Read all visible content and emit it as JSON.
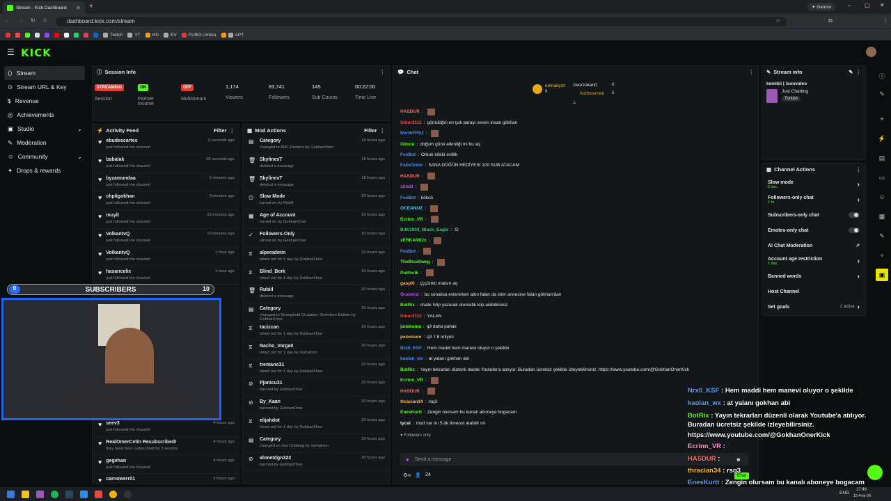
{
  "browser": {
    "tab_title": "Stream - Kick Dashboard",
    "url": "dashboard.kick.com/stream",
    "gemini": "Gemini",
    "bookmarks": [
      "Twitch",
      "YT",
      "HD",
      "EV",
      "PUBG Umbra",
      "APT"
    ]
  },
  "header": {
    "logo": "KICK"
  },
  "sidebar": {
    "items": [
      {
        "label": "Stream"
      },
      {
        "label": "Stream URL & Key"
      },
      {
        "label": "Revenue"
      },
      {
        "label": "Achievements"
      },
      {
        "label": "Studio"
      },
      {
        "label": "Moderation"
      },
      {
        "label": "Community"
      },
      {
        "label": "Drops & rewards"
      }
    ]
  },
  "session": {
    "title": "Session Info",
    "stats": [
      {
        "badge": "STREAMING",
        "label": "Session"
      },
      {
        "badge": "ON",
        "label": "Partner Income"
      },
      {
        "badge": "OFF",
        "label": "Multistream"
      },
      {
        "value": "1,174",
        "label": "Viewers"
      },
      {
        "value": "83,741",
        "label": "Followers"
      },
      {
        "value": "145",
        "label": "Sub Counts"
      },
      {
        "value": "00:22:00",
        "label": "Time Live"
      }
    ]
  },
  "activity": {
    "title": "Activity Feed",
    "filter": "Filter",
    "rows": [
      {
        "name": "ebudescartes",
        "sub": "just followed the channel",
        "time": "0 seconds ago"
      },
      {
        "name": "babalak",
        "sub": "just followed the channel",
        "time": "28 seconds ago"
      },
      {
        "name": "byzamundaa",
        "sub": "just followed the channel",
        "time": "2 minutes ago"
      },
      {
        "name": "chpligokhan",
        "sub": "just followed the channel",
        "time": "3 minutes ago"
      },
      {
        "name": "muyit",
        "sub": "just followed the channel",
        "time": "13 minutes ago"
      },
      {
        "name": "VolkantvQ",
        "sub": "just followed the channel",
        "time": "19 minutes ago"
      },
      {
        "name": "VolkantvQ",
        "sub": "just followed the channel",
        "time": "1 hour ago"
      },
      {
        "name": "hasancelix",
        "sub": "just followed the channel",
        "time": "1 hour ago"
      }
    ],
    "rows_bottom": [
      {
        "name": "seev3",
        "sub": "just followed the channel",
        "time": "4 hours ago"
      },
      {
        "name": "RealOmerCetin Resubscribed!",
        "sub": "they have been subscribed for 2 months",
        "time": "4 hours ago"
      },
      {
        "name": "gegehan",
        "sub": "just followed the channel",
        "time": "4 hours ago"
      },
      {
        "name": "carnowerr01",
        "sub": "",
        "time": "5 hours ago"
      }
    ]
  },
  "mod": {
    "title": "Mod Actions",
    "filter": "Filter",
    "rows": [
      {
        "name": "Category",
        "sub": "changed to ARC Raiders by GokhanOner",
        "time": "16 hours ago"
      },
      {
        "name": "SkylinexT",
        "sub": "deleted a message",
        "time": "18 hours ago"
      },
      {
        "name": "SkylinexT",
        "sub": "deleted a message",
        "time": "18 hours ago"
      },
      {
        "name": "Slow Mode",
        "sub": "turned on by Rubill",
        "time": "20 hours ago"
      },
      {
        "name": "Age of Account",
        "sub": "turned on by GokhanOner",
        "time": "20 hours ago"
      },
      {
        "name": "Followers-Only",
        "sub": "turned on by GokhanOner",
        "time": "20 hours ago"
      },
      {
        "name": "alperadmin",
        "sub": "timed out for 1 day by GokhanOner",
        "time": "20 hours ago"
      },
      {
        "name": "Blind_Berk",
        "sub": "timed out for 1 day by GokhanOner",
        "time": "20 hours ago"
      },
      {
        "name": "Rubiil",
        "sub": "deleted a message",
        "time": "20 hours ago"
      },
      {
        "name": "Category",
        "sub": "changed to Stronghold Crusader: Definitive Edition by GokhanOner",
        "time": "20 hours ago"
      },
      {
        "name": "tacizcan",
        "sub": "timed out for 1 day by GokhanOner",
        "time": "20 hours ago"
      },
      {
        "name": "Nacho_Varga0",
        "sub": "timed out for 1 day by muhalnnn",
        "time": "20 hours ago"
      },
      {
        "name": "tremano31",
        "sub": "timed out for 1 day by GokhanOner",
        "time": "20 hours ago"
      },
      {
        "name": "Pjanicu31",
        "sub": "banned by GokhanOner",
        "time": "20 hours ago"
      },
      {
        "name": "By_Kaan",
        "sub": "banned by GokhanOner",
        "time": "20 hours ago"
      },
      {
        "name": "elijahdot",
        "sub": "timed out for 1 day by GokhanOner",
        "time": "20 hours ago"
      },
      {
        "name": "Category",
        "sub": "changed to Just Chatting by muhalnnn",
        "time": "20 hours ago"
      },
      {
        "name": "ahmetdgn322",
        "sub": "banned by GokhanOner",
        "time": "20 hours ago"
      }
    ]
  },
  "chat": {
    "title": "Chat",
    "top": [
      "emnakyzz",
      "zworzokan0",
      "Ashbournee"
    ],
    "top_nums": [
      "9",
      "8",
      "6"
    ],
    "lines": [
      {
        "user": "HASDUR",
        "color": "#ff6b6b",
        "text": ""
      },
      {
        "user": "Umur3111",
        "color": "#ff4d4d",
        "text": "görüdüğm en çok parayı seven insan gökhan"
      },
      {
        "user": "NorthFPS2",
        "color": "#4d8cff",
        "text": ""
      },
      {
        "user": "Odocu",
        "color": "#53fc18",
        "text": "doğum günü etkinliği mi bu aq"
      },
      {
        "user": "FexBot",
        "color": "#4d8cff",
        "text": "Orkun köklü evlilik"
      },
      {
        "user": "FakeOrder",
        "color": "#4d8cff",
        "text": "SANA DÜĞÜN HEDİYESİ 100 SUB ATACAM"
      },
      {
        "user": "HASDUR",
        "color": "#ff6b6b",
        "text": ""
      },
      {
        "user": "s2m2l",
        "color": "#c14dff",
        "text": ""
      },
      {
        "user": "FexBot",
        "color": "#4d8cff",
        "text": "kökcü"
      },
      {
        "user": "OCEANUZ",
        "color": "#4dd2ff",
        "text": ""
      },
      {
        "user": "Ecrinn_VR",
        "color": "#53fc18",
        "text": ""
      },
      {
        "user": "BJK1903_Black_Eagle",
        "color": "#2ecc71",
        "text": ":D"
      },
      {
        "user": "xERKAN02x",
        "color": "#53fc18",
        "text": ""
      },
      {
        "user": "FexBot",
        "color": "#4d8cff",
        "text": ""
      },
      {
        "user": "TheBlueSweg",
        "color": "#53fc18",
        "text": ""
      },
      {
        "user": "Poliforik",
        "color": "#53fc18",
        "text": ""
      },
      {
        "user": "gaspl0",
        "color": "#ffb84d",
        "text": "çççünkü malsın aq"
      },
      {
        "user": "Oramiral",
        "color": "#c14dff",
        "text": "bu sonalisa evlenirken altın falan da ister annesine falan gökhan'dan"
      },
      {
        "user": "BotRix",
        "color": "#53fc18",
        "text": "chate !clip yazarak otomatik klip alabilirsiniz."
      },
      {
        "user": "Umur3111",
        "color": "#ff4d4d",
        "text": "YALAN"
      },
      {
        "user": "jadakoma",
        "color": "#53fc18",
        "text": "q3 daha pahalı"
      },
      {
        "user": "pexenson",
        "color": "#ffb84d",
        "text": "q3 7 8 milyon"
      },
      {
        "user": "Nrx0_KSF",
        "color": "#4d8cff",
        "text": "Hem maddi hem manevi oluyor o şekilde"
      },
      {
        "user": "kaolan_wx",
        "color": "#4d8cff",
        "text": "at yalanı gokhan abi"
      },
      {
        "user": "BotRix",
        "color": "#53fc18",
        "text": "Yayın tekrarları düzenli olarak Youtube'a atılıyor. Buradan ücretsiz şekilde izleyebilirsiniz. https://www.youtube.com/@GokhanOnerKick"
      },
      {
        "user": "Ecrinn_VR",
        "color": "#53fc18",
        "text": ""
      },
      {
        "user": "HASDUR",
        "color": "#ff6b6b",
        "text": ""
      },
      {
        "user": "thracian34",
        "color": "#ffb84d",
        "text": "rsq3"
      },
      {
        "user": "EnesKurtt",
        "color": "#53fc18",
        "text": "Zengin olursam bu kanalı aboneye bogacam"
      },
      {
        "user": "tycal",
        "color": "#e6e8ea",
        "text": "mod var mı 5 dk timeout atabilir mi"
      }
    ],
    "followers_only": "Followers only",
    "placeholder": "Send a message",
    "count": "24",
    "chat_btn": "Chat"
  },
  "stream_info": {
    "title": "Stream info",
    "tags": "kemikli | !sonvideo",
    "category": "Just Chatting",
    "lang": "Turkish"
  },
  "channel_actions": {
    "title": "Channel Actions",
    "items": [
      {
        "label": "Slow mode",
        "sub": "2 sec",
        "ctrl": "chev"
      },
      {
        "label": "Followers-only chat",
        "sub": "1 hr",
        "ctrl": "chev"
      },
      {
        "label": "Subscribers-only chat",
        "sub": "",
        "ctrl": "tog"
      },
      {
        "label": "Emotes-only chat",
        "sub": "",
        "ctrl": "tog"
      },
      {
        "label": "AI Chat Moderation",
        "sub": "",
        "ctrl": "ext"
      },
      {
        "label": "Account age restriction",
        "sub": "1 day",
        "ctrl": "chev"
      },
      {
        "label": "Banned words",
        "sub": "",
        "ctrl": "chev"
      },
      {
        "label": "Host Channel",
        "sub": "",
        "ctrl": ""
      },
      {
        "label": "Set goals",
        "sub": "",
        "ctrl": "goals"
      }
    ],
    "goals_active": "2 active"
  },
  "overlay": {
    "sub_label": "SUBSCRIBERS",
    "sub_left": "0",
    "sub_right": "10",
    "lines": [
      {
        "user": "Nrx0_KSF",
        "color": "#5aa0ff",
        "text": "Hem maddi hem manevi oluyor o şekilde"
      },
      {
        "user": "kaolan_wx",
        "color": "#5aa0ff",
        "text": "at yalanı gokhan abi"
      },
      {
        "user": "BotRix",
        "color": "#53fc18",
        "text": "Yayın tekrarları düzenli olarak Youtube'a atılıyor."
      },
      {
        "user": "",
        "color": "#fff",
        "text": "Buradan ücretsiz şekilde izleyebilirsiniz."
      },
      {
        "user": "",
        "color": "#fff",
        "text": "https://www.youtube.com/@GokhanOnerKick"
      },
      {
        "user": "Ecrinn_VR",
        "color": "#ff9ad5",
        "text": ""
      },
      {
        "user": "HASDUR",
        "color": "#ff6b6b",
        "text": ""
      },
      {
        "user": "thracian34",
        "color": "#ffb84d",
        "text": "rsq3"
      },
      {
        "user": "EnesKurtt",
        "color": "#5aa0ff",
        "text": "Zengin olursam bu kanalı aboneye bogacam"
      }
    ]
  },
  "taskbar": {
    "lang": "ENG",
    "time": "17:46",
    "date": "15-Feb-26"
  }
}
